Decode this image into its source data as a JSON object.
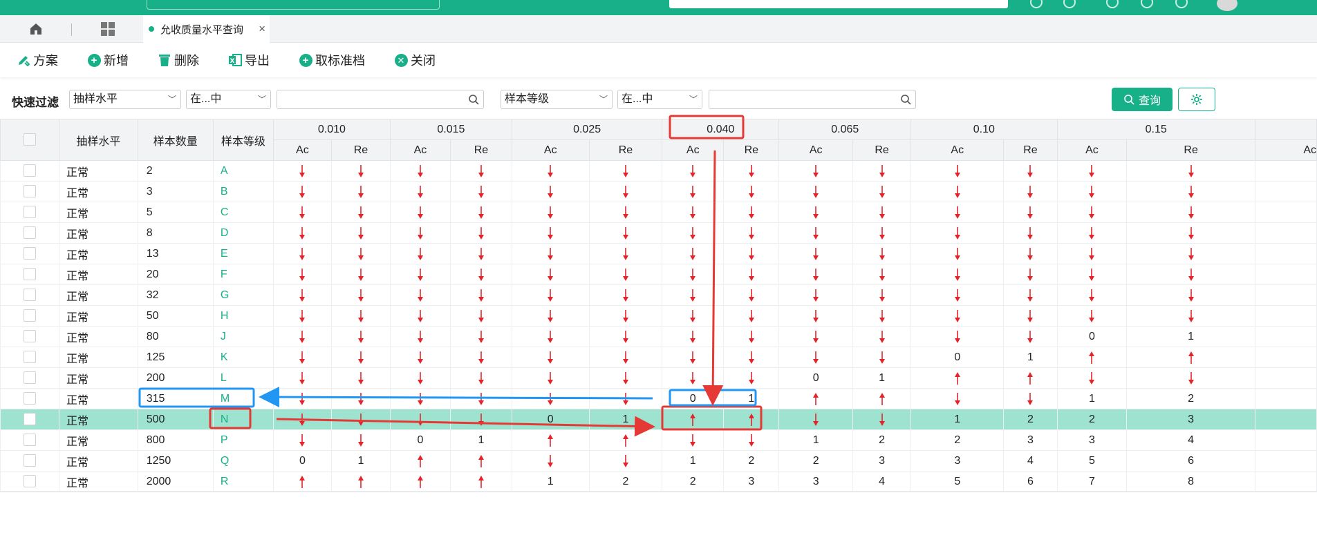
{
  "tabs": {
    "active_label": "允收质量水平查询"
  },
  "toolbar": {
    "plan": "方案",
    "add": "新增",
    "delete": "删除",
    "export": "导出",
    "cancel_archive": "取标准档",
    "close": "关闭"
  },
  "filter": {
    "label": "快速过滤",
    "field1": "抽样水平",
    "op1": "在...中",
    "field2": "样本等级",
    "op2": "在...中",
    "query": "查询"
  },
  "table": {
    "headers": {
      "level": "抽样水平",
      "count": "样本数量",
      "code": "样本等级",
      "ac": "Ac",
      "re": "Re"
    },
    "aql": [
      "0.010",
      "0.015",
      "0.025",
      "0.040",
      "0.065",
      "0.10",
      "0.15"
    ],
    "rows": [
      {
        "level": "正常",
        "count": "2",
        "code": "A",
        "cells": [
          "D",
          "D",
          "D",
          "D",
          "D",
          "D",
          "D",
          "D",
          "D",
          "D",
          "D",
          "D",
          "D",
          "D"
        ]
      },
      {
        "level": "正常",
        "count": "3",
        "code": "B",
        "cells": [
          "D",
          "D",
          "D",
          "D",
          "D",
          "D",
          "D",
          "D",
          "D",
          "D",
          "D",
          "D",
          "D",
          "D"
        ]
      },
      {
        "level": "正常",
        "count": "5",
        "code": "C",
        "cells": [
          "D",
          "D",
          "D",
          "D",
          "D",
          "D",
          "D",
          "D",
          "D",
          "D",
          "D",
          "D",
          "D",
          "D"
        ]
      },
      {
        "level": "正常",
        "count": "8",
        "code": "D",
        "cells": [
          "D",
          "D",
          "D",
          "D",
          "D",
          "D",
          "D",
          "D",
          "D",
          "D",
          "D",
          "D",
          "D",
          "D"
        ]
      },
      {
        "level": "正常",
        "count": "13",
        "code": "E",
        "cells": [
          "D",
          "D",
          "D",
          "D",
          "D",
          "D",
          "D",
          "D",
          "D",
          "D",
          "D",
          "D",
          "D",
          "D"
        ]
      },
      {
        "level": "正常",
        "count": "20",
        "code": "F",
        "cells": [
          "D",
          "D",
          "D",
          "D",
          "D",
          "D",
          "D",
          "D",
          "D",
          "D",
          "D",
          "D",
          "D",
          "D"
        ]
      },
      {
        "level": "正常",
        "count": "32",
        "code": "G",
        "cells": [
          "D",
          "D",
          "D",
          "D",
          "D",
          "D",
          "D",
          "D",
          "D",
          "D",
          "D",
          "D",
          "D",
          "D"
        ]
      },
      {
        "level": "正常",
        "count": "50",
        "code": "H",
        "cells": [
          "D",
          "D",
          "D",
          "D",
          "D",
          "D",
          "D",
          "D",
          "D",
          "D",
          "D",
          "D",
          "D",
          "D"
        ]
      },
      {
        "level": "正常",
        "count": "80",
        "code": "J",
        "cells": [
          "D",
          "D",
          "D",
          "D",
          "D",
          "D",
          "D",
          "D",
          "D",
          "D",
          "D",
          "D",
          "0",
          "1"
        ]
      },
      {
        "level": "正常",
        "count": "125",
        "code": "K",
        "cells": [
          "D",
          "D",
          "D",
          "D",
          "D",
          "D",
          "D",
          "D",
          "D",
          "D",
          "0",
          "1",
          "U",
          "U"
        ]
      },
      {
        "level": "正常",
        "count": "200",
        "code": "L",
        "cells": [
          "D",
          "D",
          "D",
          "D",
          "D",
          "D",
          "D",
          "D",
          "0",
          "1",
          "U",
          "U",
          "D",
          "D"
        ]
      },
      {
        "level": "正常",
        "count": "315",
        "code": "M",
        "cells": [
          "D",
          "D",
          "D",
          "D",
          "D",
          "D",
          "0",
          "1",
          "U",
          "U",
          "D",
          "D",
          "1",
          "2"
        ]
      },
      {
        "level": "正常",
        "count": "500",
        "code": "N",
        "cells": [
          "D",
          "D",
          "D",
          "D",
          "0",
          "1",
          "U",
          "U",
          "D",
          "D",
          "1",
          "2",
          "2",
          "3"
        ]
      },
      {
        "level": "正常",
        "count": "800",
        "code": "P",
        "cells": [
          "D",
          "D",
          "0",
          "1",
          "U",
          "U",
          "D",
          "D",
          "1",
          "2",
          "2",
          "3",
          "3",
          "4"
        ]
      },
      {
        "level": "正常",
        "count": "1250",
        "code": "Q",
        "cells": [
          "0",
          "1",
          "U",
          "U",
          "D",
          "D",
          "1",
          "2",
          "2",
          "3",
          "3",
          "4",
          "5",
          "6"
        ]
      },
      {
        "level": "正常",
        "count": "2000",
        "code": "R",
        "cells": [
          "U",
          "U",
          "U",
          "U",
          "1",
          "2",
          "2",
          "3",
          "3",
          "4",
          "5",
          "6",
          "7",
          "8"
        ]
      }
    ]
  },
  "colors": {
    "brand": "#18b088",
    "selected_row": "#9de3d0",
    "arrow": "#e3242b",
    "annotation_red": "#e53935",
    "annotation_blue": "#2196f3"
  }
}
